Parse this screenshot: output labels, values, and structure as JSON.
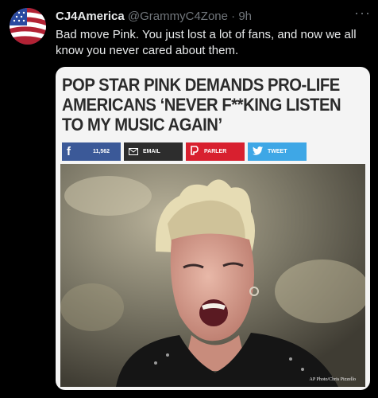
{
  "tweet": {
    "display_name": "CJ4America",
    "handle": "@GrammyC4Zone",
    "separator": "·",
    "time": "9h",
    "text": "Bad move Pink.  You just lost a lot of fans, and now we all know you never cared about them.",
    "more_icon": "more-dots-icon"
  },
  "card": {
    "headline": "POP STAR PINK DEMANDS PRO-LIFE AMERICANS ‘NEVER F**KING LISTEN TO MY MUSIC AGAIN’",
    "share": {
      "facebook_icon": "f",
      "facebook_count": "11,562",
      "email_label": "EMAIL",
      "parler_label": "PARLER",
      "tweet_label": "TWEET"
    },
    "photo_credit": "AP Photo/Chris Pizzello"
  },
  "colors": {
    "background": "#000000",
    "facebook": "#3b5998",
    "email": "#2d2d2d",
    "parler": "#d8202f",
    "twitter": "#3ea7e6"
  }
}
